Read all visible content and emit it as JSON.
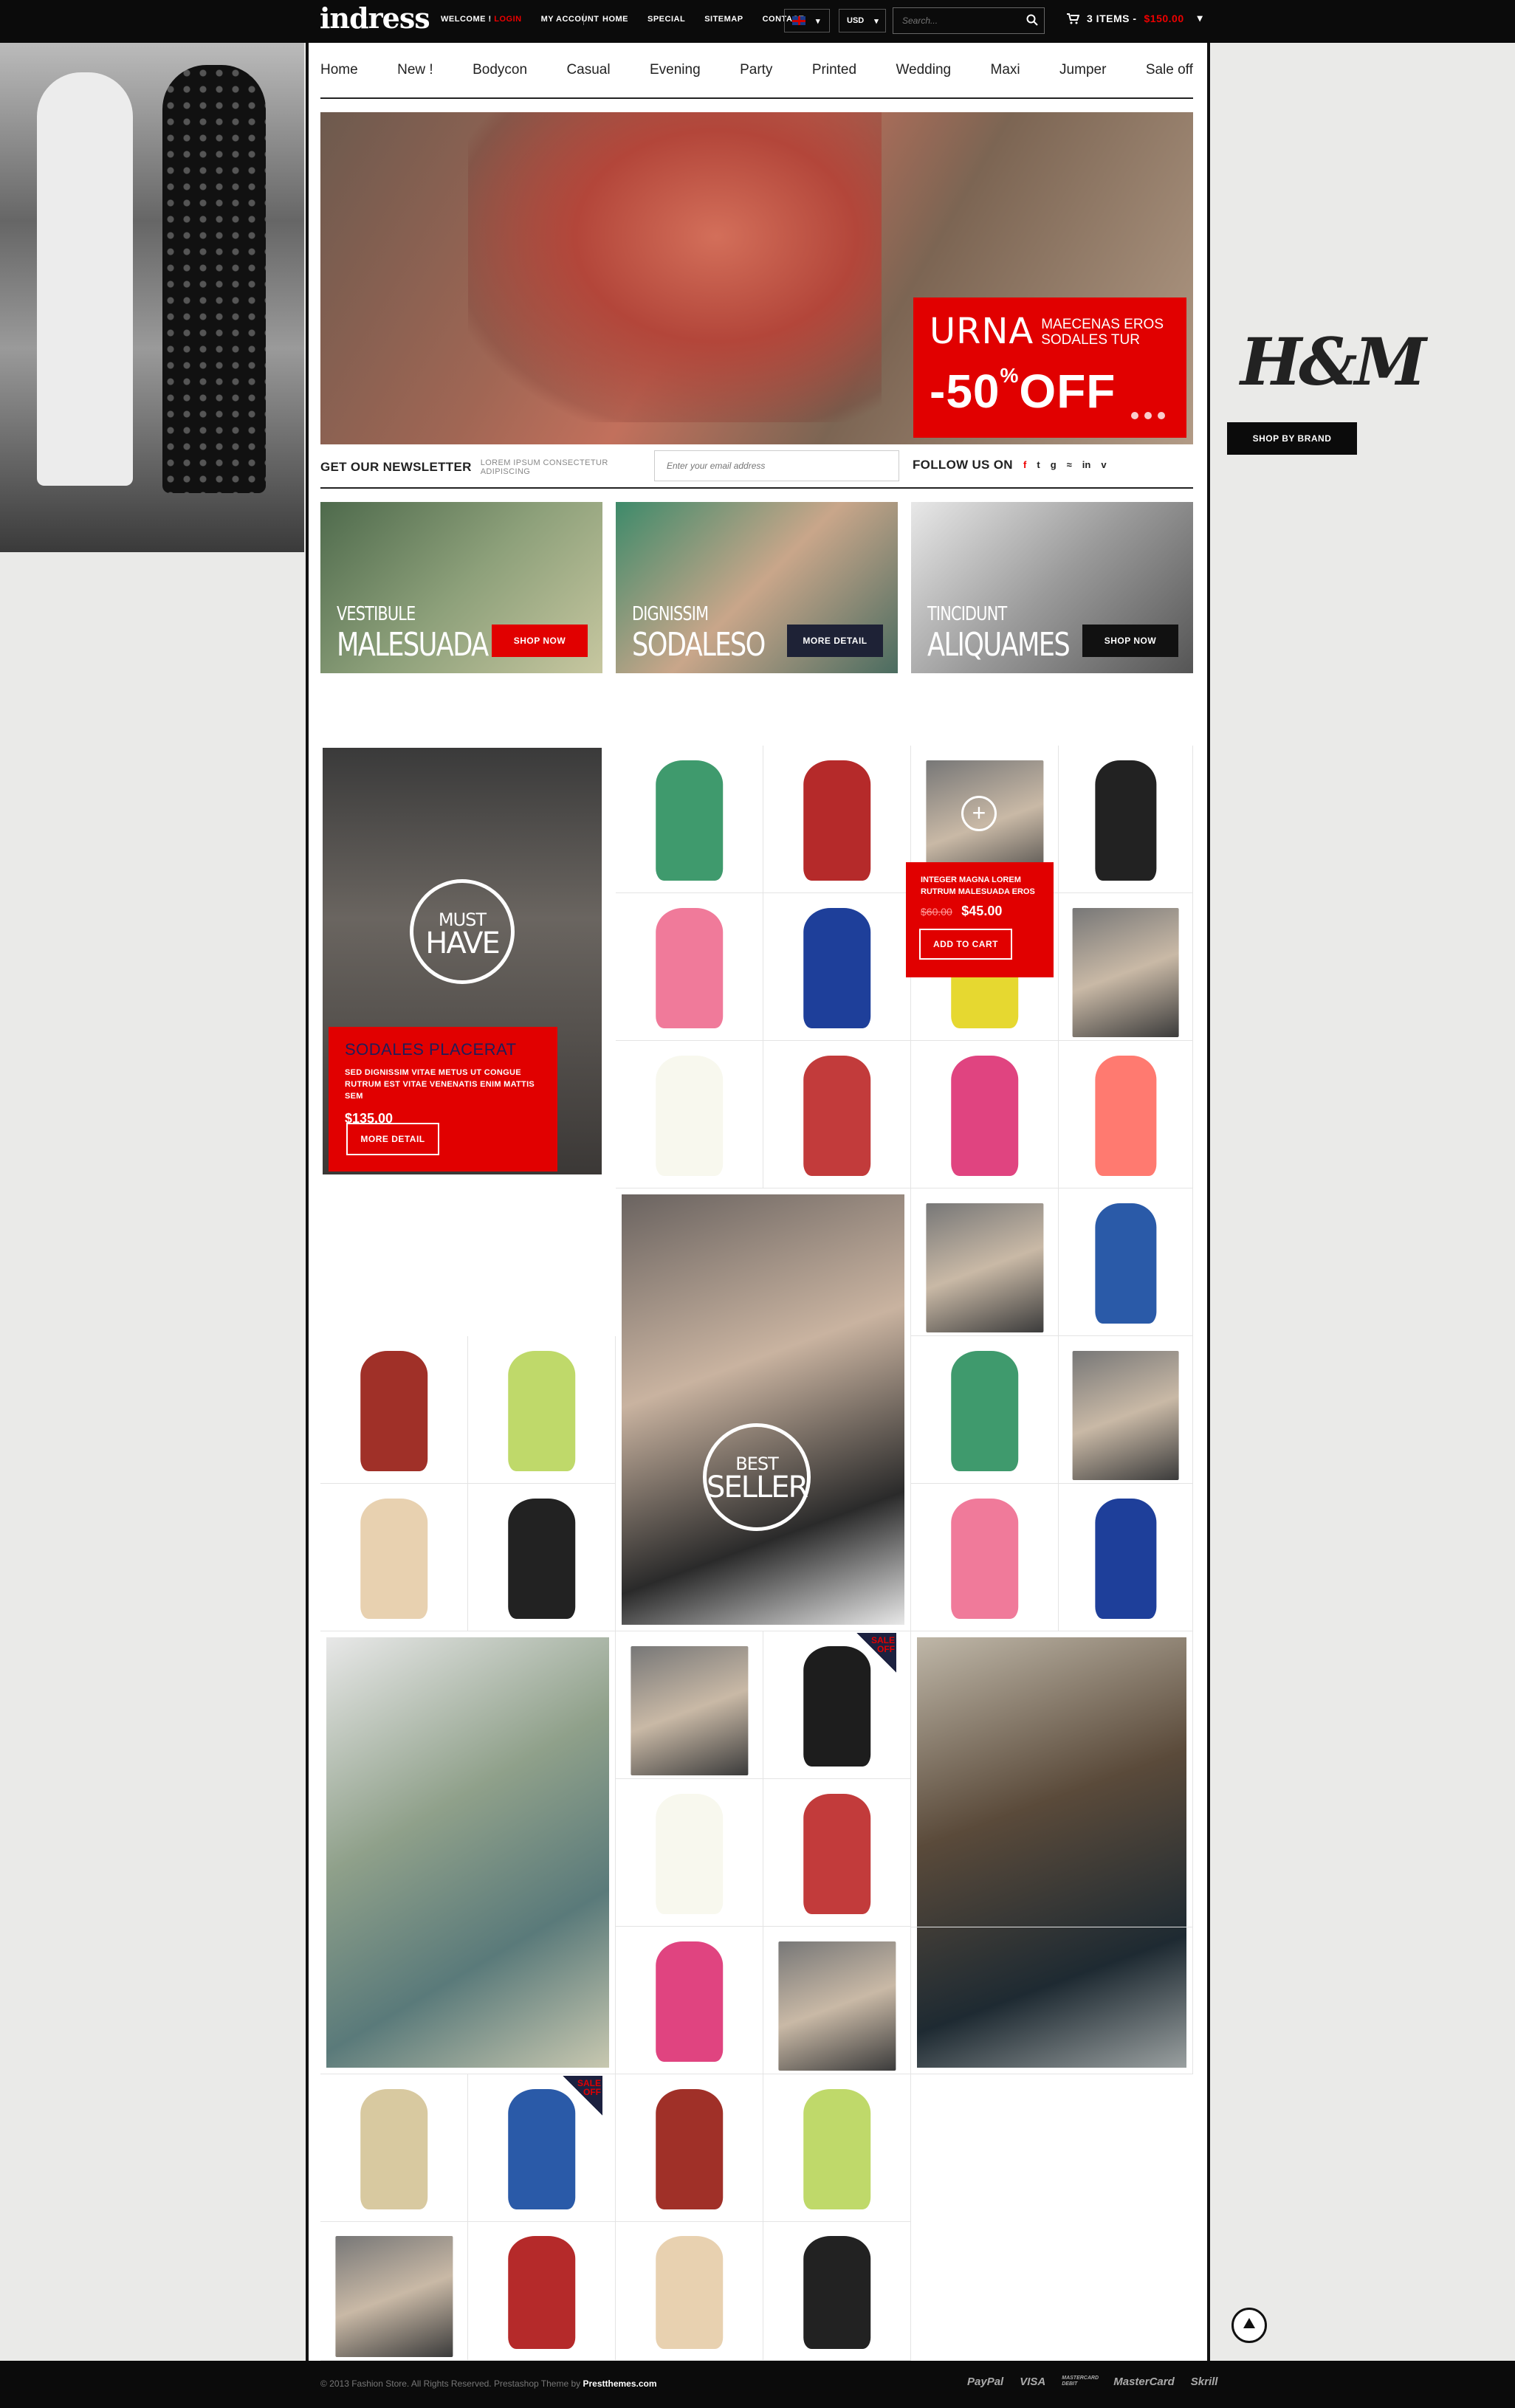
{
  "header": {
    "logo": "indress",
    "welcome": "WELCOME !",
    "login": "LOGIN",
    "my_account": "MY ACCOUNT",
    "links": [
      "HOME",
      "SPECIAL",
      "SITEMAP",
      "CONTACT"
    ],
    "currency": "USD",
    "search_placeholder": "Search...",
    "cart_items": "3 ITEMS -",
    "cart_price": "$150.00"
  },
  "nav": [
    "Home",
    "New !",
    "Bodycon",
    "Casual",
    "Evening",
    "Party",
    "Printed",
    "Wedding",
    "Maxi",
    "Jumper",
    "Sale off"
  ],
  "brand": {
    "logo": "H&M",
    "button": "SHOP BY BRAND"
  },
  "hero": {
    "title": "URNA",
    "subtitle": "MAECENAS EROS SODALES TUR",
    "offer": "-50",
    "offer_sup": "%",
    "offer_word": "OFF"
  },
  "newsletter": {
    "title": "GET OUR NEWSLETTER",
    "subtitle": "LOREM IPSUM CONSECTETUR ADIPISCING",
    "placeholder": "Enter your email address",
    "follow": "FOLLOW US ON",
    "social": [
      "f",
      "t",
      "g",
      "rss",
      "in",
      "v"
    ]
  },
  "promos": [
    {
      "line1": "VESTIBULE",
      "line2": "MALESUADA",
      "button": "SHOP NOW"
    },
    {
      "line1": "DIGNISSIM",
      "line2": "SODALESO",
      "button": "MORE DETAIL"
    },
    {
      "line1": "TINCIDUNT",
      "line2": "ALIQUAMES",
      "button": "SHOP NOW"
    }
  ],
  "must_have": {
    "line1": "MUST",
    "line2": "HAVE",
    "title": "SODALES PLACERAT",
    "desc": "SED DIGNISSIM VITAE METUS UT CONGUE RUTRUM EST VITAE VENENATIS ENIM MATTIS SEM",
    "price": "$135.00",
    "button": "MORE DETAIL"
  },
  "hover_card": {
    "name": "INTEGER MAGNA LOREM RUTRUM MALESUADA EROS",
    "old_price": "$60.00",
    "price": "$45.00",
    "button": "ADD TO CART"
  },
  "best_seller": {
    "line1": "BEST",
    "line2": "SELLER"
  },
  "sale_badge": "SALE OFF",
  "footer": {
    "copyright": "© 2013 Fashion Store. All Rights Reserved. Prestashop Theme by",
    "author": "Prestthemes.com",
    "payments": [
      "PayPal",
      "VISA",
      "MASTERCARD DEBIT",
      "MasterCard",
      "Skrill"
    ]
  }
}
